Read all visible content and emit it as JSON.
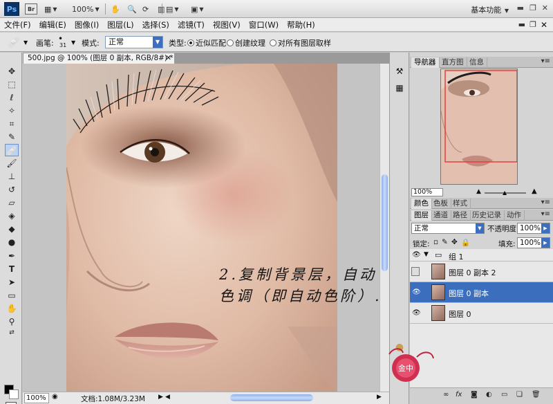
{
  "titlebar": {
    "logo": "Ps",
    "bridge": "Br",
    "zoom": "100%",
    "workspace": "基本功能"
  },
  "menu": {
    "items": [
      "文件(F)",
      "编辑(E)",
      "图像(I)",
      "图层(L)",
      "选择(S)",
      "滤镜(T)",
      "视图(V)",
      "窗口(W)",
      "帮助(H)"
    ]
  },
  "options": {
    "brush_label": "画笔:",
    "brush_size": "31",
    "mode_label": "模式:",
    "mode_value": "正常",
    "type_label": "类型:",
    "type_options": [
      "近似匹配",
      "创建纹理"
    ],
    "sample_all": "对所有图层取样"
  },
  "document": {
    "tab_title": "500.jpg @ 100% (图层 0 副本, RGB/8#) *",
    "annotation": "2.复制背景层，自动色调（即自动色阶）.",
    "status_zoom": "100%",
    "status_info": "文档:1.08M/3.23M"
  },
  "navigator": {
    "tabs": [
      "导航器",
      "直方图",
      "信息"
    ],
    "zoom": "100%"
  },
  "color_panel": {
    "tabs": [
      "颜色",
      "色板",
      "样式"
    ]
  },
  "layers_panel": {
    "tabs": [
      "图层",
      "通道",
      "路径",
      "历史记录",
      "动作"
    ],
    "blend_mode": "正常",
    "opacity_label": "不透明度:",
    "opacity_value": "100%",
    "lock_label": "锁定:",
    "fill_label": "填充:",
    "fill_value": "100%",
    "layers": [
      {
        "name": "组 1",
        "type": "group",
        "visible": true,
        "selected": false
      },
      {
        "name": "图层 0 副本 2",
        "type": "layer",
        "visible": false,
        "selected": false
      },
      {
        "name": "图层 0 副本",
        "type": "layer",
        "visible": true,
        "selected": true
      },
      {
        "name": "图层 0",
        "type": "layer",
        "visible": true,
        "selected": false
      }
    ]
  },
  "colors": {
    "selection": "#3b6ebc",
    "nav_frame": "#e04040"
  },
  "watermark": "金中"
}
